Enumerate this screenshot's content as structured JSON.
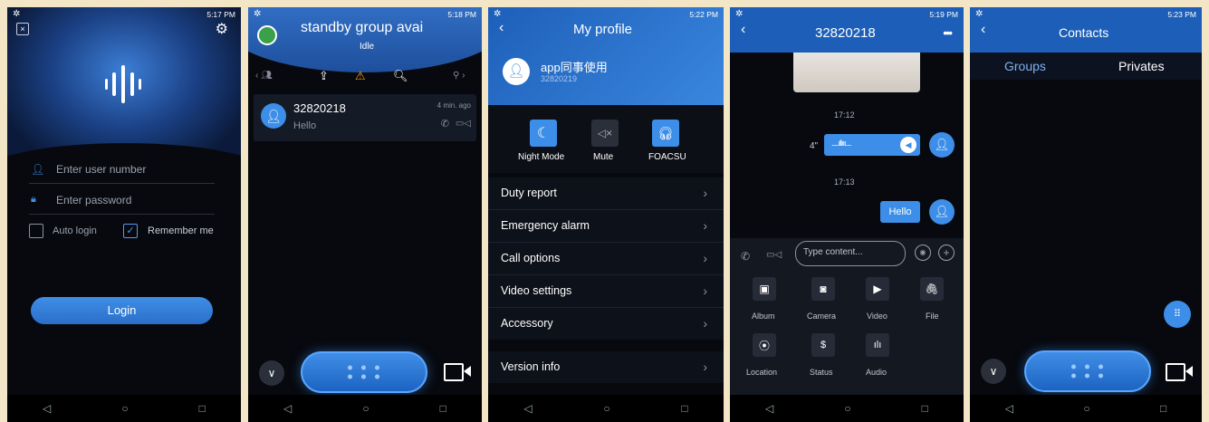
{
  "screens": {
    "login": {
      "status_time": "5:17 PM",
      "user_placeholder": "Enter user number",
      "password_placeholder": "Enter password",
      "auto_login": "Auto login",
      "remember_me": "Remember me",
      "login_button": "Login"
    },
    "group": {
      "status_time": "5:18 PM",
      "title": "standby group avai",
      "subtitle": "Idle",
      "item_name": "32820218",
      "item_message": "Hello",
      "item_time": "4 min. ago"
    },
    "profile": {
      "status_time": "5:22 PM",
      "title": "My profile",
      "user_name": "app同事使用",
      "user_id": "32820219",
      "quick": [
        "Night Mode",
        "Mute",
        "FOACSU"
      ],
      "menu": [
        "Duty report",
        "Emergency alarm",
        "Call options",
        "Video settings",
        "Accessory",
        "Version info"
      ]
    },
    "chat": {
      "status_time": "5:19 PM",
      "title": "32820218",
      "time1": "17:12",
      "voice_duration": "4\"",
      "time2": "17:13",
      "text_message": "Hello",
      "input_placeholder": "Type content...",
      "tools": [
        "Album",
        "Camera",
        "Video",
        "File",
        "Location",
        "Status",
        "Audio"
      ]
    },
    "contacts": {
      "status_time": "5:23 PM",
      "title": "Contacts",
      "tab_groups": "Groups",
      "tab_privates": "Privates"
    }
  },
  "colors": {
    "accent": "#2a7ee0",
    "header_blue": "#1d5fb8",
    "dark_bg": "#07090e",
    "menu_bg": "#0d1119"
  }
}
